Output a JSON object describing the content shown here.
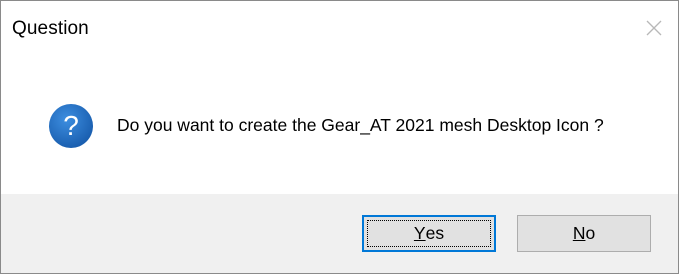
{
  "dialog": {
    "title": "Question",
    "message": "Do you want to create the Gear_AT 2021 mesh Desktop Icon ?",
    "icon": "question-icon",
    "icon_color": "#1a64b8",
    "buttons": {
      "yes": {
        "accel": "Y",
        "rest": "es",
        "is_default": true
      },
      "no": {
        "accel": "N",
        "rest": "o",
        "is_default": false
      }
    }
  },
  "colors": {
    "accent": "#0078d7",
    "footer_bg": "#f0f0f0",
    "button_bg": "#e1e1e1"
  }
}
